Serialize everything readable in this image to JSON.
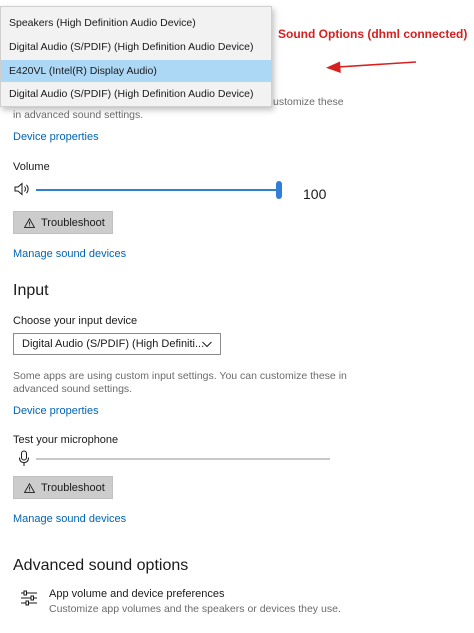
{
  "output_device_dropdown": {
    "options": [
      "Speakers (High Definition Audio Device)",
      "Digital Audio (S/PDIF) (High Definition Audio Device)",
      "E420VL (Intel(R) Display Audio)",
      "Digital Audio (S/PDIF) (High Definition Audio Device)"
    ],
    "selected_index": 2
  },
  "annotation": {
    "text": "Sound Options (dhml connected)",
    "color": "#d61f1f"
  },
  "output": {
    "hidden_note_line1": "ustomize these",
    "hidden_note_line2": "in advanced sound settings.",
    "device_properties": "Device properties",
    "volume_label": "Volume",
    "volume_value": "100",
    "volume_level": 1.0,
    "troubleshoot": "Troubleshoot",
    "manage_devices": "Manage sound devices"
  },
  "input": {
    "heading": "Input",
    "choose_label": "Choose your input device",
    "selected_device": "Digital Audio (S/PDIF) (High Definiti...",
    "note_line1": "Some apps are using custom input settings. You can customize these in",
    "note_line2": "advanced sound settings.",
    "device_properties": "Device properties",
    "test_label": "Test your microphone",
    "mic_level": 0.0,
    "troubleshoot": "Troubleshoot",
    "manage_devices": "Manage sound devices"
  },
  "advanced": {
    "heading": "Advanced sound options",
    "item_title": "App volume and device preferences",
    "item_desc": "Customize app volumes and the speakers or devices they use."
  },
  "colors": {
    "accent": "#2f7ed8",
    "link": "#0064b4",
    "selection": "#add8f5"
  }
}
